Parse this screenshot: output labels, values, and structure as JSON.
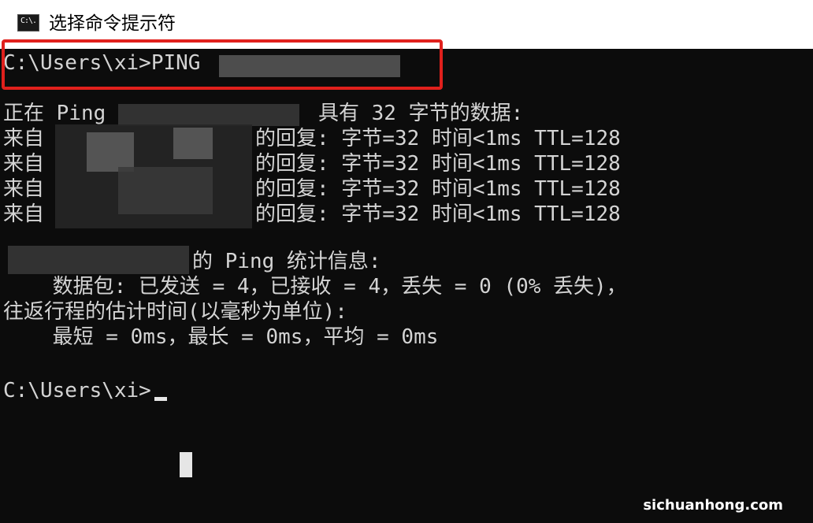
{
  "window": {
    "title": "选择命令提示符",
    "icon_label": "C:\\."
  },
  "console": {
    "command_line": "C:\\Users\\xi>PING",
    "ping_header_pre": "正在 Ping",
    "ping_header_post": "具有 32 字节的数据:",
    "reply_prefix": "来自",
    "reply_text": "的回复: 字节=32 时间<1ms TTL=128",
    "stats_header": "的 Ping 统计信息:",
    "packets": "    数据包: 已发送 = 4，已接收 = 4，丢失 = 0 (0% 丢失)，",
    "rtt_header": "往返行程的估计时间(以毫秒为单位):",
    "rtt_values": "    最短 = 0ms，最长 = 0ms，平均 = 0ms",
    "prompt": "C:\\Users\\xi>"
  },
  "watermark": "sichuanhong.com",
  "colors": {
    "console_bg": "#0c0c0c",
    "console_text": "#d4d4d4",
    "highlight": "#e0201c"
  }
}
